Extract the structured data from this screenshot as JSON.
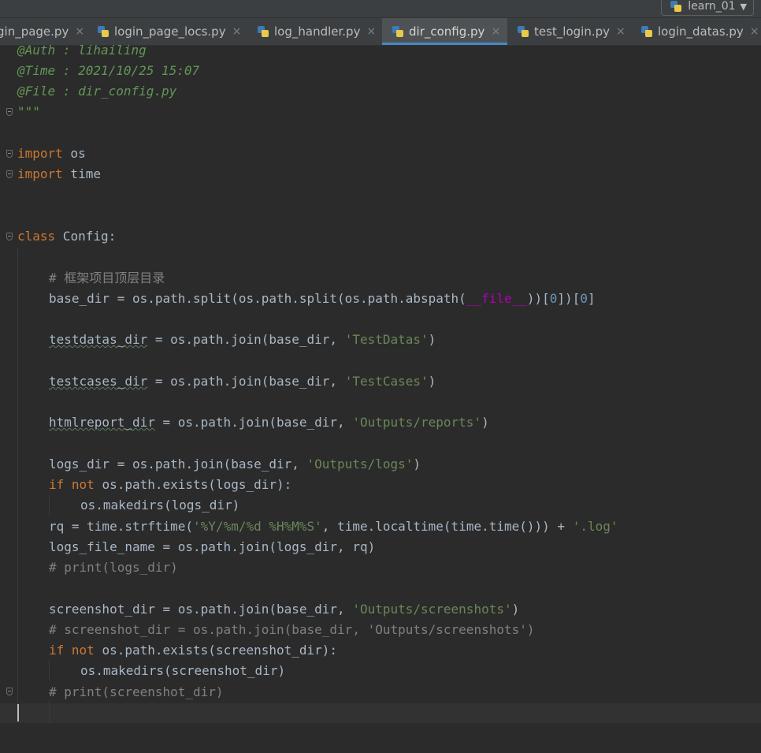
{
  "window": {
    "project_selector": {
      "label": "learn_01",
      "icon": "python-icon",
      "arrow": "▼"
    }
  },
  "tabs": [
    {
      "label": "gin_page.py",
      "icon": "",
      "active": false
    },
    {
      "label": "login_page_locs.py",
      "icon": "python-file-icon",
      "active": false
    },
    {
      "label": "log_handler.py",
      "icon": "python-file-icon",
      "active": false
    },
    {
      "label": "dir_config.py",
      "icon": "python-file-icon",
      "active": true
    },
    {
      "label": "test_login.py",
      "icon": "python-file-icon",
      "active": false
    },
    {
      "label": "login_datas.py",
      "icon": "python-file-icon",
      "active": false
    }
  ],
  "tab_close_glyph": "×",
  "colors": {
    "background": "#2b2b2b",
    "keyword": "#cc7832",
    "string": "#6a8759",
    "comment": "#808080",
    "docstring": "#629755",
    "number": "#6897bb",
    "dunder": "#b200b2",
    "accent": "#4a88c7"
  },
  "code": {
    "l1": {
      "t": "@Auth : lihailing"
    },
    "l2": {
      "t": "@Time : 2021/10/25 15:07"
    },
    "l3": {
      "t": "@File : dir_config.py"
    },
    "l4": {
      "t": "\"\"\""
    },
    "l6": {
      "k": "import",
      "t": " os"
    },
    "l7": {
      "k": "import",
      "t": " time"
    },
    "l10": {
      "k": "class",
      "t": " Config:"
    },
    "l12": {
      "c": "# 框架项目顶层目录"
    },
    "l13": {
      "a": "base_dir = os.path.split(os.path.split(os.path.abspath(",
      "d": "__file__",
      "b": "))[",
      "n1": "0",
      "e": "])[",
      "n2": "0",
      "f": "]"
    },
    "l15": {
      "a": "testdatas_dir",
      "b": " = os.path.join(base_dir, ",
      "s": "'TestDatas'",
      "e": ")"
    },
    "l17": {
      "a": "testcases_dir",
      "b": " = os.path.join(base_dir, ",
      "s": "'TestCases'",
      "e": ")"
    },
    "l19": {
      "a": "htmlreport_dir",
      "b": " = os.path.join(base_dir, ",
      "s": "'Outputs/reports'",
      "e": ")"
    },
    "l21": {
      "a": "logs_dir = os.path.join(base_dir, ",
      "s": "'Outputs/logs'",
      "e": ")"
    },
    "l22": {
      "k1": "if",
      "k2": "not",
      "t": " os.path.exists(logs_dir):"
    },
    "l23": {
      "t": "os.makedirs(logs_dir)"
    },
    "l24": {
      "a": "rq = time.strftime(",
      "s1": "'%Y/%m/%d %H%M%S'",
      "b": ", time.localtime(time.time())) + ",
      "s2": "'.log'"
    },
    "l25": {
      "t": "logs_file_name = os.path.join(logs_dir, rq)"
    },
    "l26": {
      "c": "# print(logs_dir)"
    },
    "l28": {
      "a": "screenshot_dir = os.path.join(base_dir, ",
      "s": "'Outputs/screenshots'",
      "e": ")"
    },
    "l29": {
      "c": "# screenshot_dir = os.path.join(base_dir, 'Outputs/screenshots')"
    },
    "l30": {
      "k1": "if",
      "k2": "not",
      "t": " os.path.exists(screenshot_dir):"
    },
    "l31": {
      "t": "os.makedirs(screenshot_dir)"
    },
    "l32": {
      "c": "# print(screenshot_dir)"
    }
  }
}
